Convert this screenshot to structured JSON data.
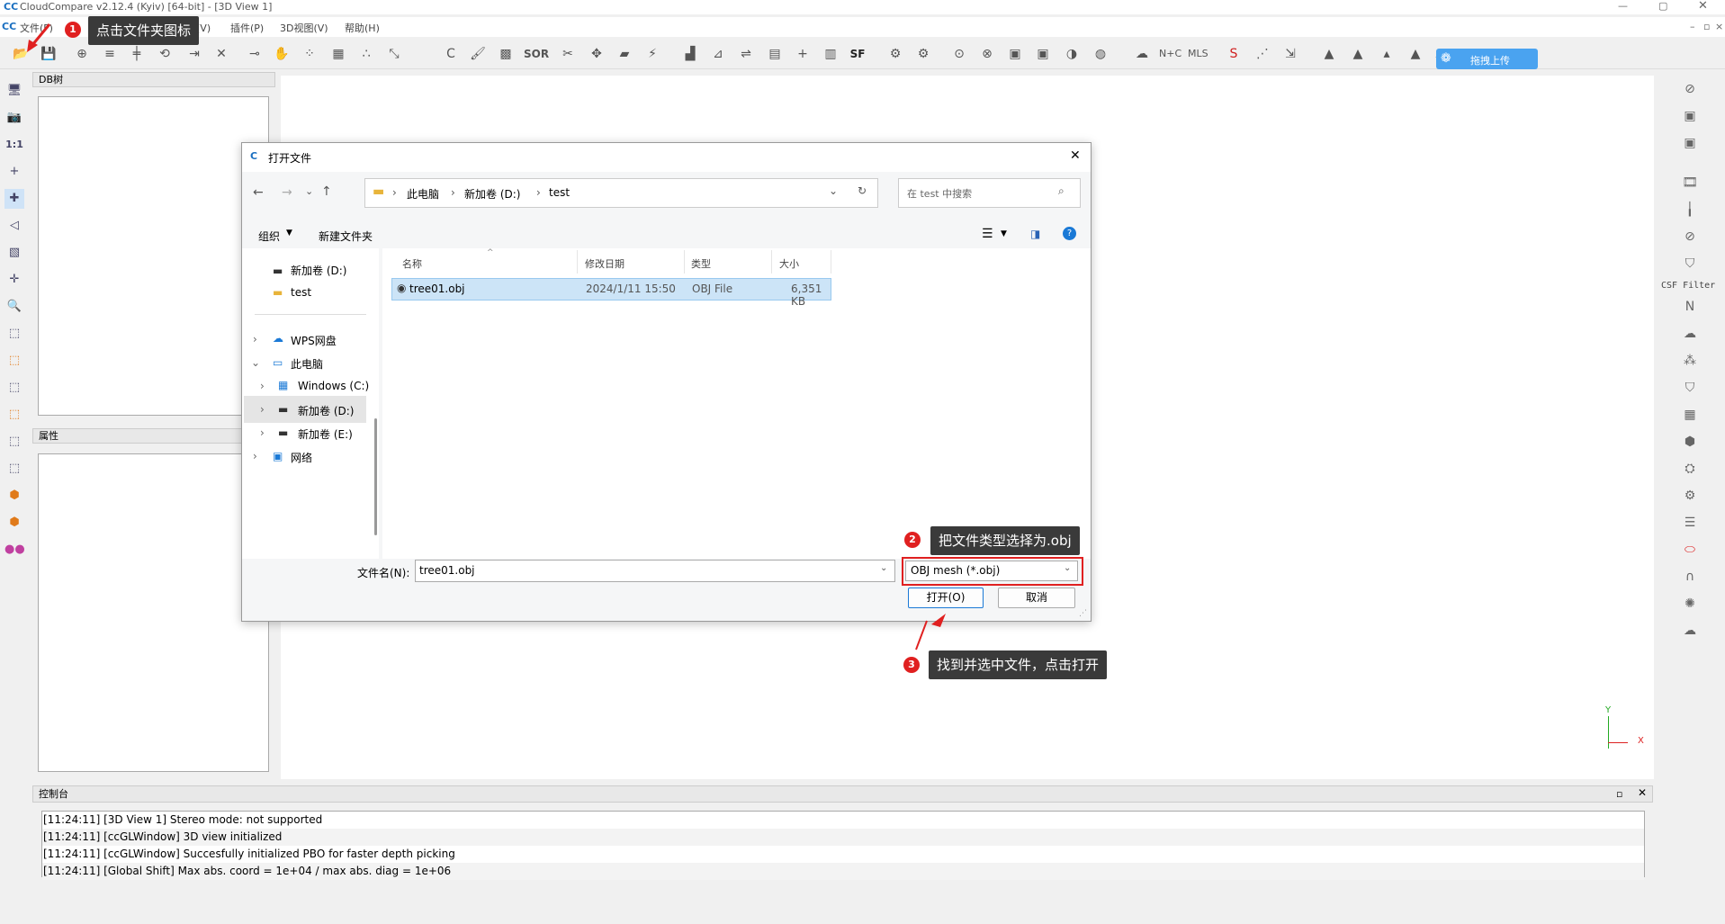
{
  "window": {
    "title": "CloudCompare v2.12.4 (Kyiv) [64-bit] - [3D View 1]"
  },
  "menu": [
    "文件(F)",
    "显示(V)",
    "插件(P)",
    "3D视图(V)",
    "帮助(H)"
  ],
  "upload_button": "拖拽上传",
  "panels": {
    "db_tree": "DB树",
    "properties": "属性",
    "console": "控制台"
  },
  "console_lines": [
    "[11:24:11] [3D View 1] Stereo mode: not supported",
    "[11:24:11] [ccGLWindow] 3D view initialized",
    "[11:24:11] [ccGLWindow] Succesfully initialized PBO for faster depth picking",
    "[11:24:11] [Global Shift] Max abs. coord = 1e+04 / max abs. diag = 1e+06"
  ],
  "dialog": {
    "title": "打开文件",
    "breadcrumb": [
      "此电脑",
      "新加卷 (D:)",
      "test"
    ],
    "search_placeholder": "在 test 中搜索",
    "organize": "组织",
    "new_folder": "新建文件夹",
    "nav": [
      "新加卷 (D:)",
      "test",
      "WPS网盘",
      "此电脑",
      "Windows (C:)",
      "新加卷 (D:)",
      "新加卷 (E:)",
      "网络"
    ],
    "columns": {
      "name": "名称",
      "date": "修改日期",
      "type": "类型",
      "size": "大小"
    },
    "file": {
      "name": "tree01.obj",
      "date": "2024/1/11 15:50",
      "type": "OBJ File",
      "size": "6,351 KB"
    },
    "filename_label": "文件名(N):",
    "filename_value": "tree01.obj",
    "filetype": "OBJ mesh (*.obj)",
    "open": "打开(O)",
    "cancel": "取消"
  },
  "annotations": {
    "step1": "点击文件夹图标",
    "step2": "把文件类型选择为.obj",
    "step3": "找到并选中文件，点击打开",
    "n1": "1",
    "n2": "2",
    "n3": "3"
  },
  "right_labels": {
    "csf": "CSF Filter",
    "n": "N"
  },
  "colors": {
    "callout_bg": "#3a3a3a",
    "badge": "#e02020",
    "highlight_border": "#e02020",
    "selection": "#cce4f7",
    "upload": "#4aa3f0"
  }
}
